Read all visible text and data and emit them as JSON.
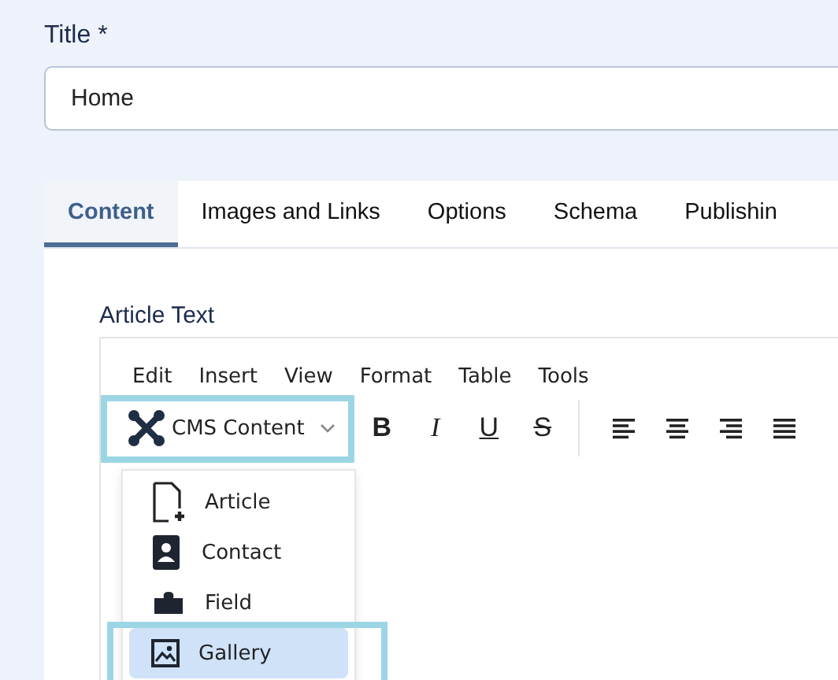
{
  "title_field": {
    "label": "Title *",
    "value": "Home"
  },
  "tabs": [
    {
      "label": "Content",
      "selected": true
    },
    {
      "label": "Images and Links",
      "selected": false
    },
    {
      "label": "Options",
      "selected": false
    },
    {
      "label": "Schema",
      "selected": false
    },
    {
      "label": "Publishin",
      "selected": false
    }
  ],
  "editor": {
    "label": "Article Text",
    "menu": [
      "Edit",
      "Insert",
      "View",
      "Format",
      "Table",
      "Tools"
    ],
    "cms_button": {
      "label": "CMS Content",
      "highlighted": true
    },
    "format_buttons": [
      {
        "kind": "bold",
        "label": "B"
      },
      {
        "kind": "italic",
        "label": "I"
      },
      {
        "kind": "underline",
        "label": "U"
      },
      {
        "kind": "strike",
        "label": "S"
      }
    ],
    "align_buttons": [
      {
        "kind": "left"
      },
      {
        "kind": "center"
      },
      {
        "kind": "right"
      },
      {
        "kind": "justify"
      }
    ],
    "dropdown": [
      {
        "kind": "article",
        "label": "Article",
        "selected": false,
        "highlighted": false
      },
      {
        "kind": "contact",
        "label": "Contact",
        "selected": false,
        "highlighted": false
      },
      {
        "kind": "field",
        "label": "Field",
        "selected": false,
        "highlighted": false
      },
      {
        "kind": "gallery",
        "label": "Gallery",
        "selected": true,
        "highlighted": true
      }
    ]
  }
}
